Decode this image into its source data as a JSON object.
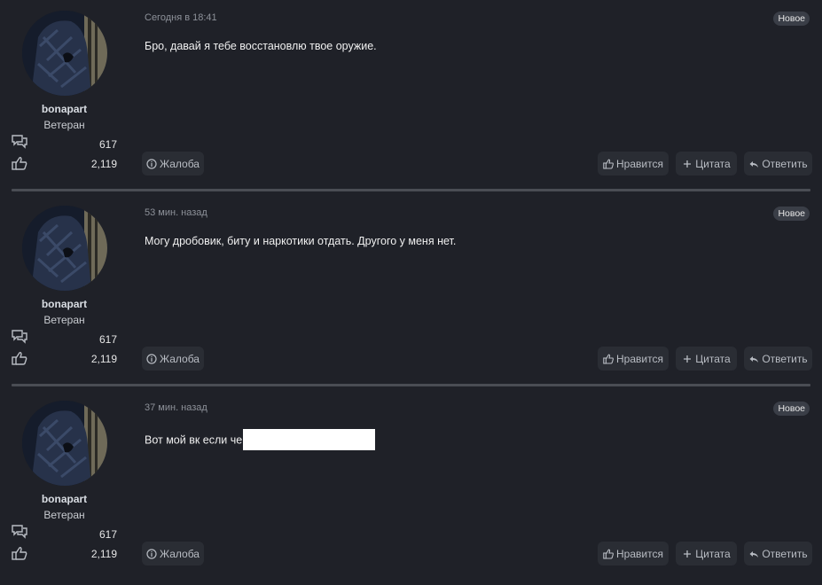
{
  "posts": [
    {
      "author": {
        "name": "bonapart",
        "rank": "Ветеран",
        "messages": "617",
        "likes": "2,119"
      },
      "time": "Сегодня в 18:41",
      "badge": "Новое",
      "content": "Бро, давай я тебе восстановлю твое оружие.",
      "actions": {
        "report": "Жалоба",
        "like": "Нравится",
        "quote": "Цитата",
        "reply": "Ответить"
      }
    },
    {
      "author": {
        "name": "bonapart",
        "rank": "Ветеран",
        "messages": "617",
        "likes": "2,119"
      },
      "time": "53 мин. назад",
      "badge": "Новое",
      "content": "Могу дробовик, биту и наркотики отдать. Другого у меня нет.",
      "actions": {
        "report": "Жалоба",
        "like": "Нравится",
        "quote": "Цитата",
        "reply": "Ответить"
      }
    },
    {
      "author": {
        "name": "bonapart",
        "rank": "Ветеран",
        "messages": "617",
        "likes": "2,119"
      },
      "time": "37 мин. назад",
      "badge": "Новое",
      "content": "Вот мой вк если че",
      "actions": {
        "report": "Жалоба",
        "like": "Нравится",
        "quote": "Цитата",
        "reply": "Ответить"
      }
    }
  ],
  "icons": {
    "messages": "speech-bubbles-icon",
    "likes": "thumbs-up-icon",
    "report": "info-circle-icon",
    "like": "thumbs-up-icon",
    "quote": "plus-icon",
    "reply": "reply-arrow-icon"
  },
  "colors": {
    "background": "#1f2128",
    "button": "#2a2d34",
    "badge": "#3a3e47",
    "divider": "#4a4d54",
    "muted_text": "#8d9199"
  }
}
